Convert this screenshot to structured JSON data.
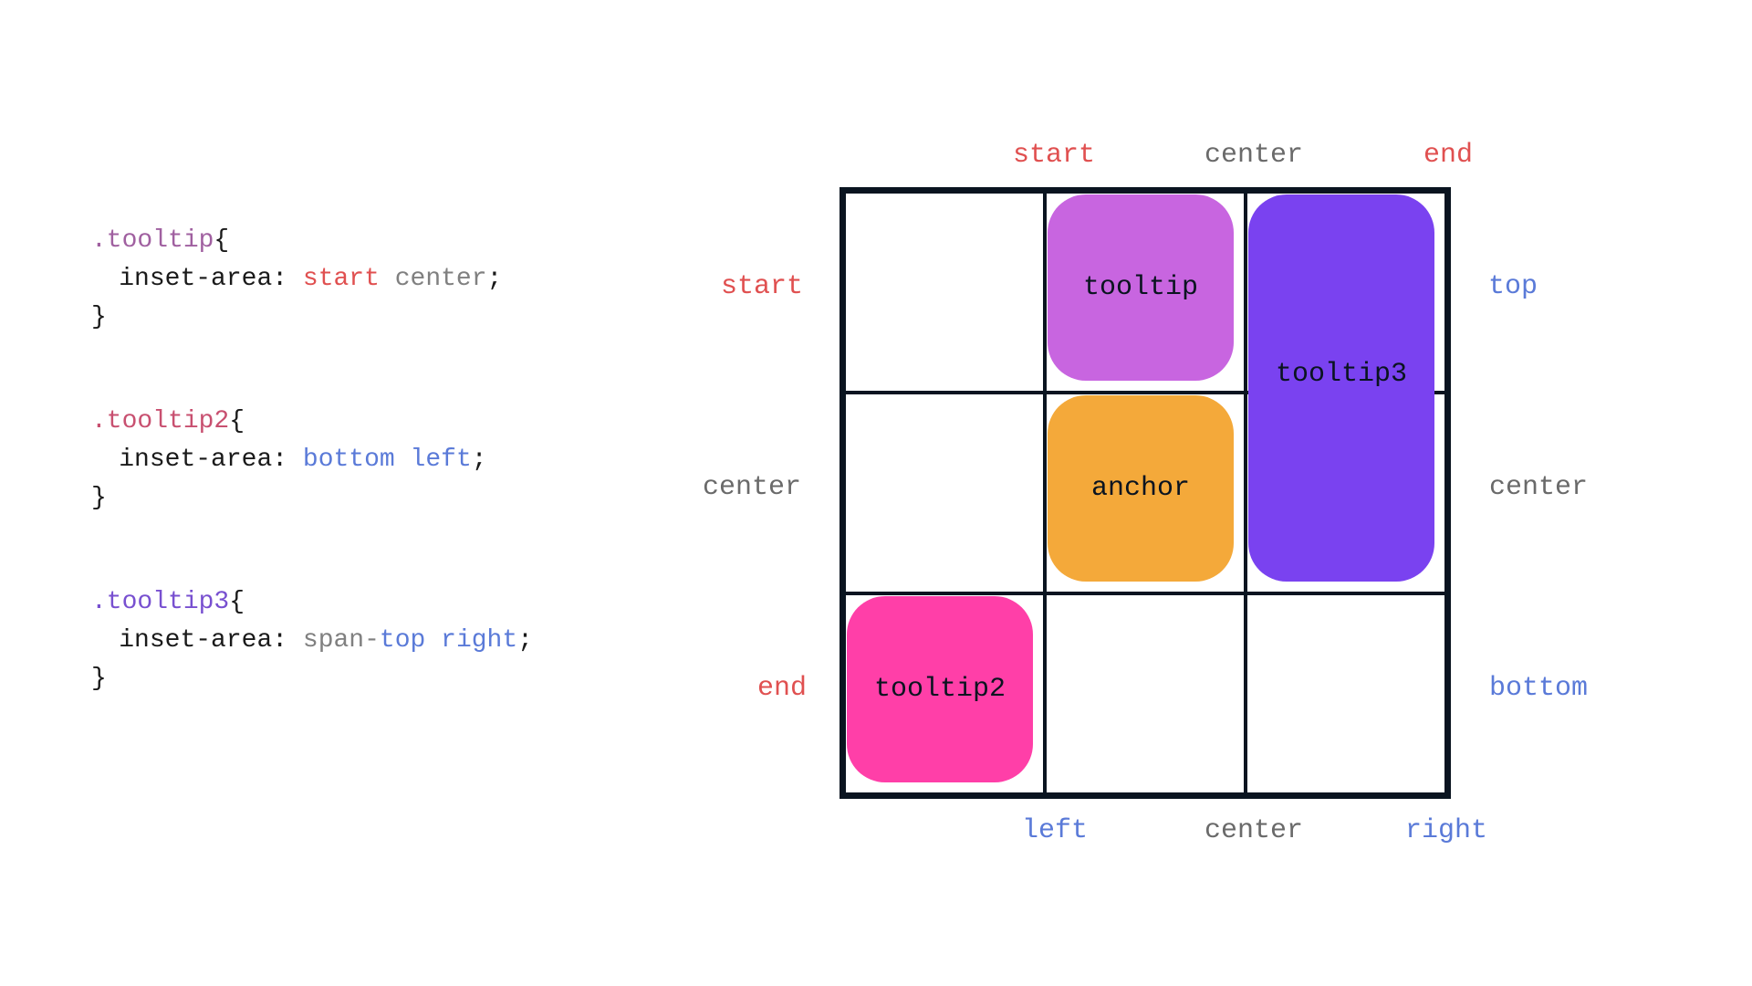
{
  "code": {
    "tooltip": {
      "selector": ".tooltip",
      "open": "{",
      "prop": "inset-area:",
      "val1": "start",
      "val2": "center",
      "semicolon": ";",
      "close": "}"
    },
    "tooltip2": {
      "selector": ".tooltip2",
      "open": "{",
      "prop": "inset-area:",
      "val1": "bottom",
      "val2": "left",
      "semicolon": ";",
      "close": "}"
    },
    "tooltip3": {
      "selector": ".tooltip3",
      "open": "{",
      "prop": "inset-area:",
      "val_prefix": "span-",
      "val_mid": "top",
      "val2": "right",
      "semicolon": ";",
      "close": "}"
    }
  },
  "grid": {
    "top": {
      "start": "start",
      "center": "center",
      "end": "end"
    },
    "bottom": {
      "left": "left",
      "center": "center",
      "right": "right"
    },
    "left": {
      "start": "start",
      "center": "center",
      "end": "end"
    },
    "right": {
      "top": "top",
      "center": "center",
      "bottom": "bottom"
    },
    "blobs": {
      "tooltip": "tooltip",
      "anchor": "anchor",
      "tooltip2": "tooltip2",
      "tooltip3": "tooltip3"
    }
  },
  "colors": {
    "red": "#e05050",
    "gray": "#6a6a6a",
    "blue": "#5a7ad8",
    "tooltip": "#c865e0",
    "anchor": "#f4a93a",
    "tooltip2": "#ff3fa8",
    "tooltip3": "#7a42f0",
    "grid_border": "#0a1420"
  }
}
